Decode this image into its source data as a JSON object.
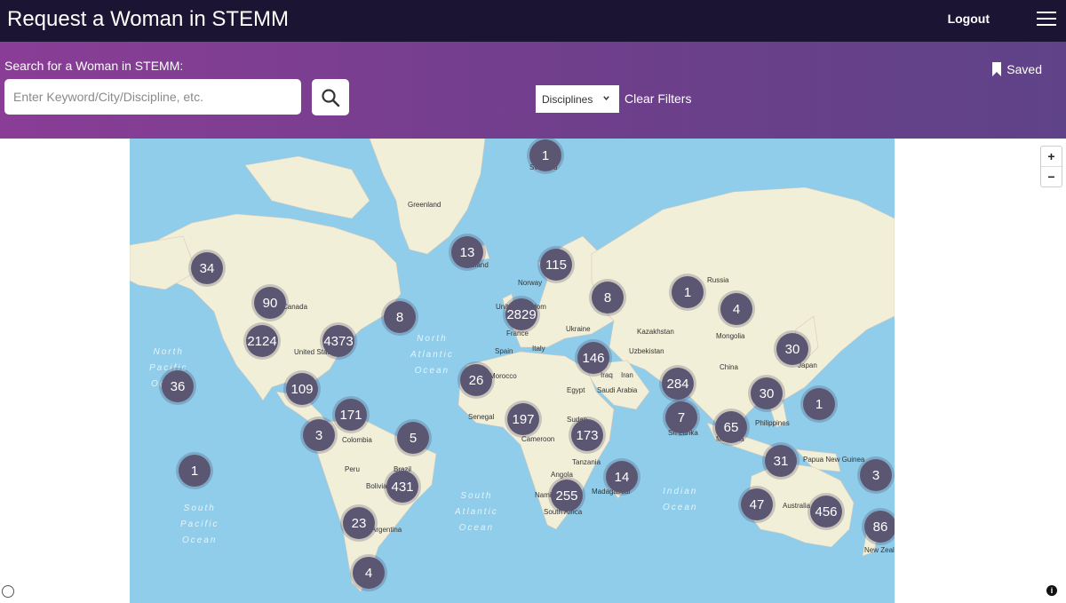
{
  "header": {
    "title": "Request a Woman in STEMM",
    "logout_label": "Logout",
    "menu_icon": "hamburger-menu-icon"
  },
  "search": {
    "label": "Search for a Woman in STEMM:",
    "placeholder": "Enter Keyword/City/Discipline, etc.",
    "value": "",
    "button_icon": "search-icon",
    "disciplines_label": "Disciplines",
    "clear_label": "Clear Filters",
    "saved_label": "Saved",
    "saved_icon": "bookmark-icon"
  },
  "map": {
    "zoom_in": "+",
    "zoom_out": "−",
    "info": "i",
    "colors": {
      "water": "#8fcdea",
      "land": "#f2efd9",
      "cluster": "#5b5772"
    },
    "places": [
      "Greenland",
      "Norway",
      "Russia",
      "Kazakhstan",
      "Mongolia",
      "China",
      "Japan",
      "Ukraine",
      "France",
      "Spain",
      "Italy",
      "Uzbekistan",
      "Iran",
      "Iraq",
      "Egypt",
      "Saudi Arabia",
      "Morocco",
      "Senegal",
      "Cameroon",
      "Sudan",
      "Tanzania",
      "Angola",
      "Namibia",
      "South Africa",
      "Madagascar",
      "Sri Lanka",
      "Malaysia",
      "Philippines",
      "Papua New Guinea",
      "Australia",
      "New Zealand",
      "United States",
      "Canada",
      "Colombia",
      "Peru",
      "Brazil",
      "Bolivia",
      "Argentina",
      "Iceland",
      "United Kingdom",
      "Svalbard"
    ],
    "oceans": [
      "North\nPacific\nOcean",
      "North\nAtlantic\nOcean",
      "South\nAtlantic\nOcean",
      "Indian\nOcean",
      "South\nPacific\nOcean"
    ],
    "clusters": [
      "1",
      "13",
      "115",
      "34",
      "90",
      "2124",
      "4373",
      "8",
      "2829",
      "8",
      "1",
      "4",
      "30",
      "146",
      "26",
      "36",
      "109",
      "171",
      "3",
      "5",
      "197",
      "173",
      "284",
      "30",
      "1",
      "7",
      "65",
      "31",
      "3",
      "14",
      "1",
      "431",
      "255",
      "47",
      "456",
      "86",
      "23",
      "4"
    ]
  }
}
